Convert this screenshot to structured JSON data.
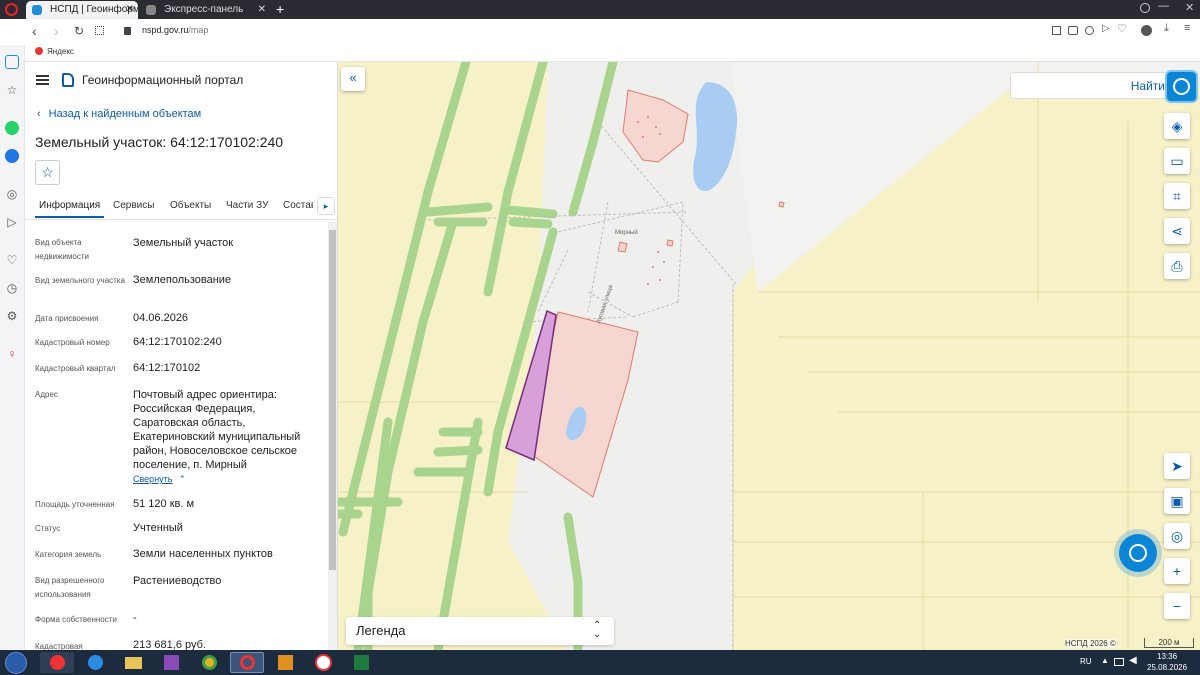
{
  "browser": {
    "tabs": [
      {
        "label": "НСПД | Геоинформацио"
      },
      {
        "label": "Экспресс-панель"
      }
    ],
    "new_tab": "+",
    "url_domain": "nspd.gov.ru",
    "url_path": "/map",
    "bookmark": "Яндекс"
  },
  "header": {
    "portal_title": "Геоинформационный портал",
    "back_link": "Назад к найденным объектам",
    "object_title": "Земельный участок: 64:12:170102:240"
  },
  "tabs": [
    {
      "label": "Информация"
    },
    {
      "label": "Сервисы"
    },
    {
      "label": "Объекты"
    },
    {
      "label": "Части ЗУ"
    },
    {
      "label": "Состав"
    }
  ],
  "fields": [
    {
      "label": "Вид объекта недвижимости",
      "value": "Земельный участок"
    },
    {
      "label": "Вид земельного участка",
      "value": "Землепользование"
    },
    {
      "label": "Дата присвоения",
      "value": "04.06.2026"
    },
    {
      "label": "Кадастровый номер",
      "value": "64:12:170102:240"
    },
    {
      "label": "Кадастровый квартал",
      "value": "64:12:170102"
    },
    {
      "label": "Адрес",
      "value": "Почтовый адрес ориентира: Российская Федерация, Саратовская область, Екатериновский муниципальный район, Новоселовское сельское поселение, п. Мирный"
    },
    {
      "label": "Площадь уточненная",
      "value": "51 120 кв. м"
    },
    {
      "label": "Статус",
      "value": "Учтенный"
    },
    {
      "label": "Категория земель",
      "value": "Земли населенных пунктов"
    },
    {
      "label": "Вид разрешенного использования",
      "value": "Растениеводство"
    },
    {
      "label": "Форма собственности",
      "value": "-"
    },
    {
      "label": "Кадастровая",
      "value": "213 681,6 руб."
    }
  ],
  "collapse_link": "Свернуть",
  "map": {
    "search_button": "Найти",
    "legend_label": "Легенда",
    "copyright": "НСПД 2026 ©",
    "scale": "200 м",
    "village_label": "Мирный",
    "street_label": "Луговая улица"
  },
  "taskbar": {
    "lang": "RU",
    "time": "13:36",
    "date": "25.08.2026"
  },
  "colors": {
    "accent": "#0b5cad",
    "selected_parcel": "#d8a0d8",
    "parcel_fill": "#f6d6d0",
    "parcel_stroke": "#e07a6a",
    "field": "#f7f1c8",
    "green_strip": "#a9d48e",
    "water": "#a9cdf2"
  }
}
